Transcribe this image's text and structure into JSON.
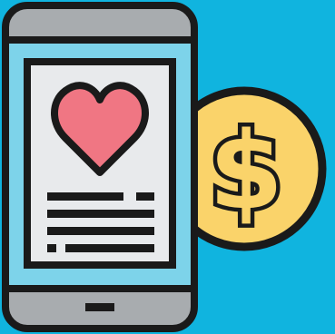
{
  "colors": {
    "background": "#10B4DF",
    "outline": "#1A1A1A",
    "phone_body": "#A8ACAF",
    "phone_screen_frame": "#7DD3EA",
    "card_background": "#E8EAEC",
    "heart": "#F07683",
    "coin": "#FAD36A",
    "home_button": "#1A1A1A"
  },
  "icons": {
    "main": "smartphone-donation-icon",
    "heart": "heart-icon",
    "coin": "dollar-coin-icon"
  },
  "coin": {
    "symbol": "$"
  }
}
